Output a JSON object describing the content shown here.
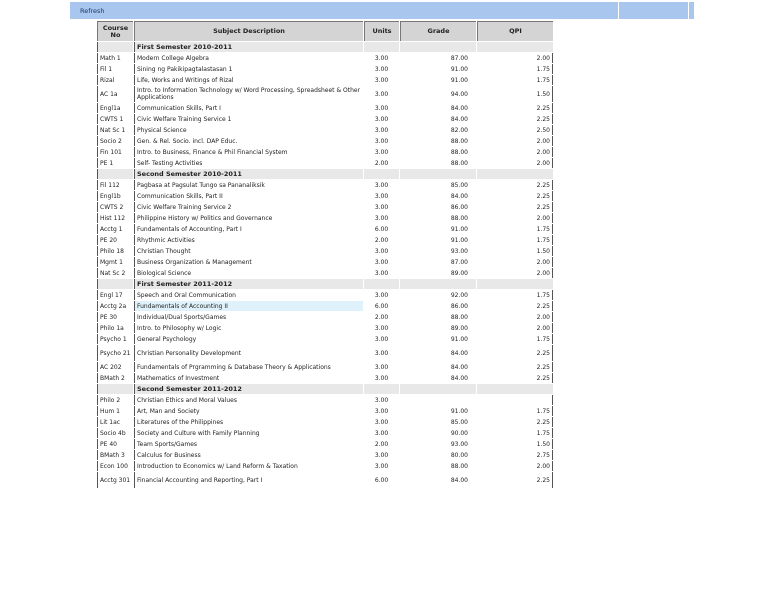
{
  "toolbar": {
    "refresh_label": "Refresh"
  },
  "headers": {
    "course_no": "Course No",
    "subject": "Subject Description",
    "units": "Units",
    "grade": "Grade",
    "qpi": "QPI"
  },
  "rows": [
    {
      "type": "sem",
      "label": "First Semester 2010-2011"
    },
    {
      "no": "Math 1",
      "desc": "Modern College Algebra",
      "units": "3.00",
      "grade": "87.00",
      "qpi": "2.00"
    },
    {
      "no": "Fil 1",
      "desc": "Sining ng Pakikipagtalastasan 1",
      "units": "3.00",
      "grade": "91.00",
      "qpi": "1.75"
    },
    {
      "no": "Rizal",
      "desc": "Life, Works and Writings of Rizal",
      "units": "3.00",
      "grade": "91.00",
      "qpi": "1.75"
    },
    {
      "no": "AC 1a",
      "desc": "Intro. to Information Technology w/ Word Processing, Spreadsheet & Other Applications",
      "units": "3.00",
      "grade": "94.00",
      "qpi": "1.50",
      "tall": true
    },
    {
      "no": "Engl1a",
      "desc": "Communication Skills, Part I",
      "units": "3.00",
      "grade": "84.00",
      "qpi": "2.25"
    },
    {
      "no": "CWTS 1",
      "desc": "Civic Welfare Training Service 1",
      "units": "3.00",
      "grade": "84.00",
      "qpi": "2.25"
    },
    {
      "no": "Nat Sc 1",
      "desc": "Physical Science",
      "units": "3.00",
      "grade": "82.00",
      "qpi": "2.50"
    },
    {
      "no": "Socio 2",
      "desc": "Gen. & Rel. Socio. incl. DAP Educ.",
      "units": "3.00",
      "grade": "88.00",
      "qpi": "2.00"
    },
    {
      "no": "Fin 101",
      "desc": "Intro. to Business, Finance & Phil Financial System",
      "units": "3.00",
      "grade": "88.00",
      "qpi": "2.00"
    },
    {
      "no": "PE 1",
      "desc": "Self- Testing Activities",
      "units": "2.00",
      "grade": "88.00",
      "qpi": "2.00"
    },
    {
      "type": "sem",
      "label": "Second Semester 2010-2011"
    },
    {
      "no": "Fil 112",
      "desc": "Pagbasa at Pagsulat Tungo sa Pananaliksik",
      "units": "3.00",
      "grade": "85.00",
      "qpi": "2.25"
    },
    {
      "no": "Engl1b",
      "desc": "Communication Skills, Part II",
      "units": "3.00",
      "grade": "84.00",
      "qpi": "2.25"
    },
    {
      "no": "CWTS 2",
      "desc": "Civic Welfare Training Service 2",
      "units": "3.00",
      "grade": "86.00",
      "qpi": "2.25"
    },
    {
      "no": "Hist 112",
      "desc": "Philippine History w/ Politics and Governance",
      "units": "3.00",
      "grade": "88.00",
      "qpi": "2.00"
    },
    {
      "no": "Acctg 1",
      "desc": "Fundamentals of Accounting, Part I",
      "units": "6.00",
      "grade": "91.00",
      "qpi": "1.75"
    },
    {
      "no": "PE 20",
      "desc": "Rhythmic Activities",
      "units": "2.00",
      "grade": "91.00",
      "qpi": "1.75"
    },
    {
      "no": "Philo 18",
      "desc": "Christian Thought",
      "units": "3.00",
      "grade": "93.00",
      "qpi": "1.50"
    },
    {
      "no": "Mgmt 1",
      "desc": "Business Organization & Management",
      "units": "3.00",
      "grade": "87.00",
      "qpi": "2.00"
    },
    {
      "no": "Nat Sc 2",
      "desc": "Biological Science",
      "units": "3.00",
      "grade": "89.00",
      "qpi": "2.00"
    },
    {
      "type": "sem",
      "label": "First Semester 2011-2012"
    },
    {
      "no": "Engl 17",
      "desc": "Speech and Oral Communication",
      "units": "3.00",
      "grade": "92.00",
      "qpi": "1.75"
    },
    {
      "no": "Acctg 2a",
      "desc": "Fundamentals of Accounting II",
      "units": "6.00",
      "grade": "86.00",
      "qpi": "2.25",
      "hl": true
    },
    {
      "no": "PE 30",
      "desc": "Individual/Dual Sports/Games",
      "units": "2.00",
      "grade": "88.00",
      "qpi": "2.00"
    },
    {
      "no": "Philo 1a",
      "desc": "Intro. to Philosophy w/ Logic",
      "units": "3.00",
      "grade": "89.00",
      "qpi": "2.00"
    },
    {
      "no": "Psycho 1",
      "desc": "General Psychology",
      "units": "3.00",
      "grade": "91.00",
      "qpi": "1.75"
    },
    {
      "no": "Psycho 21",
      "desc": "Christian Personality Development",
      "units": "3.00",
      "grade": "84.00",
      "qpi": "2.25",
      "tall": true
    },
    {
      "no": "AC 202",
      "desc": "Fundamentals of Prgramming & Database Theory & Applications",
      "units": "3.00",
      "grade": "84.00",
      "qpi": "2.25"
    },
    {
      "no": "BMath 2",
      "desc": "Mathematics of Investment",
      "units": "3.00",
      "grade": "84.00",
      "qpi": "2.25"
    },
    {
      "type": "sem",
      "label": "Second Semester 2011-2012"
    },
    {
      "no": "Philo 2",
      "desc": "Christian Ethics and Moral Values",
      "units": "3.00",
      "grade": "",
      "qpi": ""
    },
    {
      "no": "Hum 1",
      "desc": "Art, Man and Society",
      "units": "3.00",
      "grade": "91.00",
      "qpi": "1.75"
    },
    {
      "no": "Lit 1ac",
      "desc": "Literatures of the Philippines",
      "units": "3.00",
      "grade": "85.00",
      "qpi": "2.25"
    },
    {
      "no": "Socio 4b",
      "desc": "Society and Culture with Family Planning",
      "units": "3.00",
      "grade": "90.00",
      "qpi": "1.75"
    },
    {
      "no": "PE 40",
      "desc": "Team Sports/Games",
      "units": "2.00",
      "grade": "93.00",
      "qpi": "1.50"
    },
    {
      "no": "BMath 3",
      "desc": "Calculus for Business",
      "units": "3.00",
      "grade": "80.00",
      "qpi": "2.75"
    },
    {
      "no": "Econ 100",
      "desc": "Introduction to Economics w/ Land Reform & Taxation",
      "units": "3.00",
      "grade": "88.00",
      "qpi": "2.00"
    },
    {
      "no": "Acctg 301",
      "desc": "Financial Accounting and Reporting, Part I",
      "units": "6.00",
      "grade": "84.00",
      "qpi": "2.25",
      "tall": true
    }
  ]
}
